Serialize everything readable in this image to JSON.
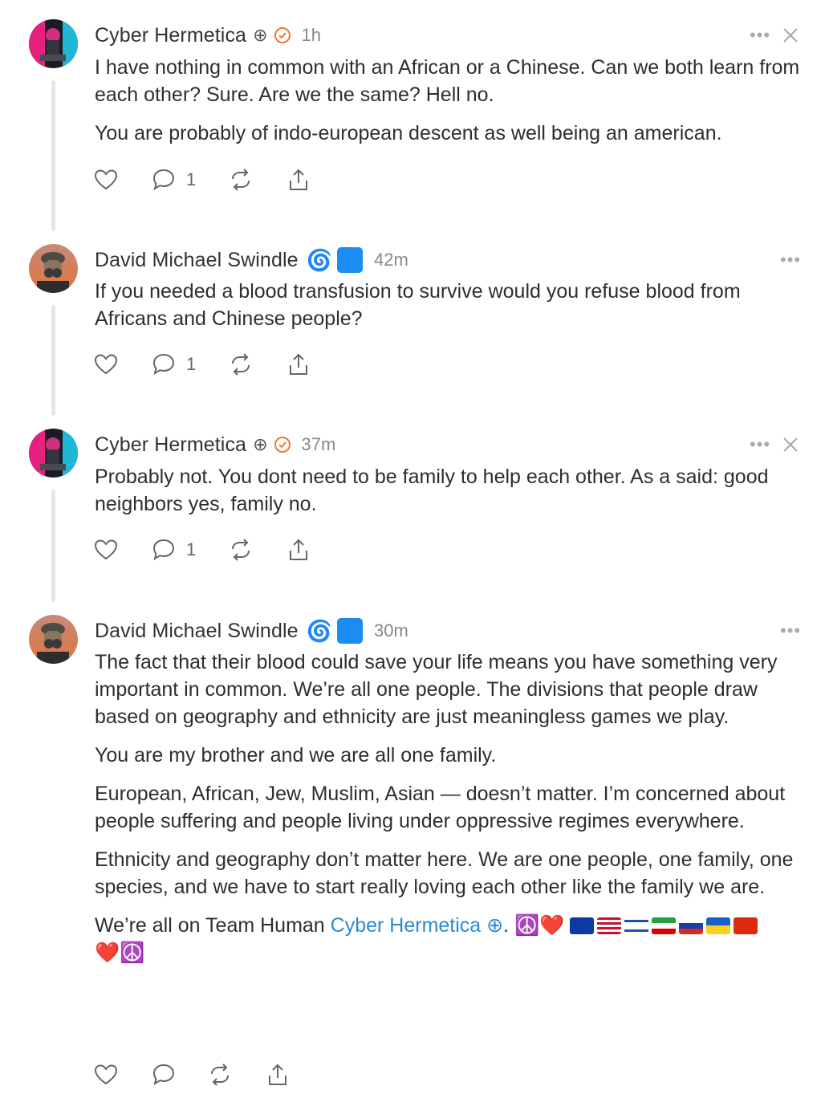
{
  "posts": [
    {
      "author": "Cyber Hermetica",
      "author_glyph": "⊕",
      "verified": true,
      "time": "1h",
      "paragraphs": [
        "I have nothing in common with an African or a Chinese. Can we both learn from each other? Sure. Are we the same? Hell no.",
        "You are probably of indo-european descent as well being an american."
      ],
      "reply_count": "1"
    },
    {
      "author": "David Michael Swindle",
      "author_badges": "🌀",
      "time": "42m",
      "paragraphs": [
        "If you needed a blood transfusion to survive would you refuse blood from Africans and Chinese people?"
      ],
      "reply_count": "1"
    },
    {
      "author": "Cyber Hermetica",
      "author_glyph": "⊕",
      "verified": true,
      "time": "37m",
      "paragraphs": [
        "Probably not. You dont need to be family to help each other. As a said: good neighbors yes, family no."
      ],
      "reply_count": "1"
    },
    {
      "author": "David Michael Swindle",
      "author_badges": "🌀",
      "time": "30m",
      "paragraphs": [
        "The fact that their blood could save your life means you have something very important in common. We’re all one people. The divisions that people draw based on geography and ethnicity are just meaningless games we play.",
        "You are my brother and we are all one family.",
        "European, African, Jew, Muslim, Asian — doesn’t matter. I’m concerned about people suffering and people living under oppressive regimes everywhere.",
        "Ethnicity and geography don’t matter here. We are one people, one family, one species, and we have to start really loving each other like the family we are."
      ],
      "last_line_prefix": "We’re all on Team Human ",
      "mention": "Cyber Hermetica ⊕",
      "after_mention": ". ",
      "emoji_peace": "☮️",
      "emoji_heart": "❤️",
      "reply_count": ""
    }
  ],
  "menu_label": "•••",
  "icons": [
    "heart-icon",
    "comment-icon",
    "repost-icon",
    "share-icon",
    "close-icon",
    "more-icon"
  ],
  "colors": {
    "accent_link": "#2a8ad2",
    "verified": "#ee7a2c",
    "muted": "#888888"
  }
}
